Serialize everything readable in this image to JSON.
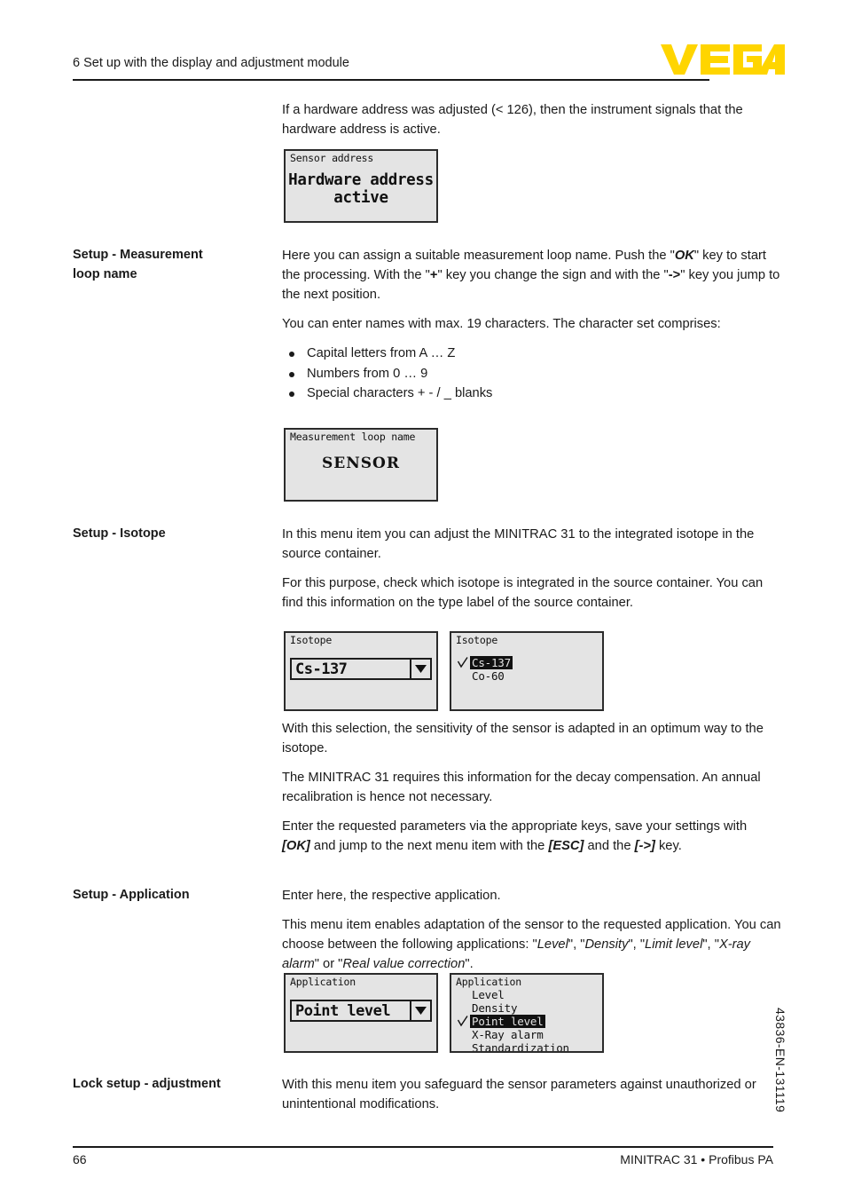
{
  "header": {
    "chapter_title": "6 Set up with the display and adjustment module",
    "logo_text": "VEGA",
    "logo_color": "#ffd500"
  },
  "intro": {
    "text": "If a hardware address was adjusted (< 126), then the instrument signals that the hardware address is active."
  },
  "displays": {
    "sensor_address": {
      "title": "Sensor address",
      "line1": "Hardware address",
      "line2": "active"
    },
    "measurement_loop_name": {
      "title": "Measurement loop name",
      "value": "SENSOR"
    },
    "isotope_select": {
      "title": "Isotope",
      "value": "Cs-137",
      "arrow_icon": "chevron-down-icon"
    },
    "isotope_list": {
      "title": "Isotope",
      "items": [
        {
          "label": "Cs-137",
          "selected": true,
          "checked": true
        },
        {
          "label": "Co-60",
          "selected": false,
          "checked": false
        }
      ]
    },
    "application_select": {
      "title": "Application",
      "value": "Point level",
      "arrow_icon": "chevron-down-icon"
    },
    "application_list": {
      "title": "Application",
      "items": [
        {
          "label": "Level",
          "selected": false,
          "checked": false
        },
        {
          "label": "Density",
          "selected": false,
          "checked": false
        },
        {
          "label": "Point level",
          "selected": true,
          "checked": true
        },
        {
          "label": "X-Ray alarm",
          "selected": false,
          "checked": false
        },
        {
          "label": "Standardization",
          "selected": false,
          "checked": false
        }
      ]
    }
  },
  "sections": {
    "loop_name": {
      "label_line1": "Setup - Measurement",
      "label_line2": "loop name",
      "para1_a": "Here you can assign a suitable measurement loop name. Push the \"",
      "para1_ok": "OK",
      "para1_b": "\" key to start the processing. With the \"",
      "para1_plus": "+",
      "para1_c": "\" key you change the sign and with the \"",
      "para1_arrow": "->",
      "para1_d": "\" key you jump to the next position.",
      "para2": "You can enter names with max. 19 characters. The character set comprises:",
      "bullets": [
        "Capital letters from A … Z",
        "Numbers from 0 … 9",
        "Special characters + - / _ blanks"
      ]
    },
    "isotope": {
      "label": "Setup - Isotope",
      "para1": "In this menu item you can adjust the MINITRAC 31 to the integrated isotope in the source container.",
      "para2": "For this purpose, check which isotope is integrated in the source container. You can find this information on the type label of the source container.",
      "para3": "With this selection, the sensitivity of the sensor is adapted in an optimum way to the isotope.",
      "para4": "The MINITRAC 31 requires this information for the decay compensation. An annual recalibration is hence not necessary.",
      "para5_a": "Enter the requested parameters via the appropriate keys, save your settings with ",
      "para5_ok": "[OK]",
      "para5_b": " and jump to the next menu item with the ",
      "para5_esc": "[ESC]",
      "para5_c": " and the ",
      "para5_arrow": "[->]",
      "para5_d": " key."
    },
    "application": {
      "label": "Setup - Application",
      "para1": "Enter here, the respective application.",
      "para2_a": "This menu item enables adaptation of the sensor to the requested application. You can choose between the following applications: \"",
      "para2_level": "Level",
      "para2_b": "\", \"",
      "para2_density": "Density",
      "para2_c": "\", \"",
      "para2_limit": "Limit level",
      "para2_d": "\", \"",
      "para2_xray": "X-ray alarm",
      "para2_e": "\" or \"",
      "para2_real": "Real value correction",
      "para2_f": "\"."
    },
    "lock": {
      "label": "Lock setup - adjustment",
      "para1": "With this menu item you safeguard the sensor parameters against unauthorized or unintentional modifications."
    }
  },
  "side": {
    "document_number": "43836-EN-131119"
  },
  "footer": {
    "page_number": "66",
    "product": "MINITRAC 31 • Profibus PA"
  }
}
